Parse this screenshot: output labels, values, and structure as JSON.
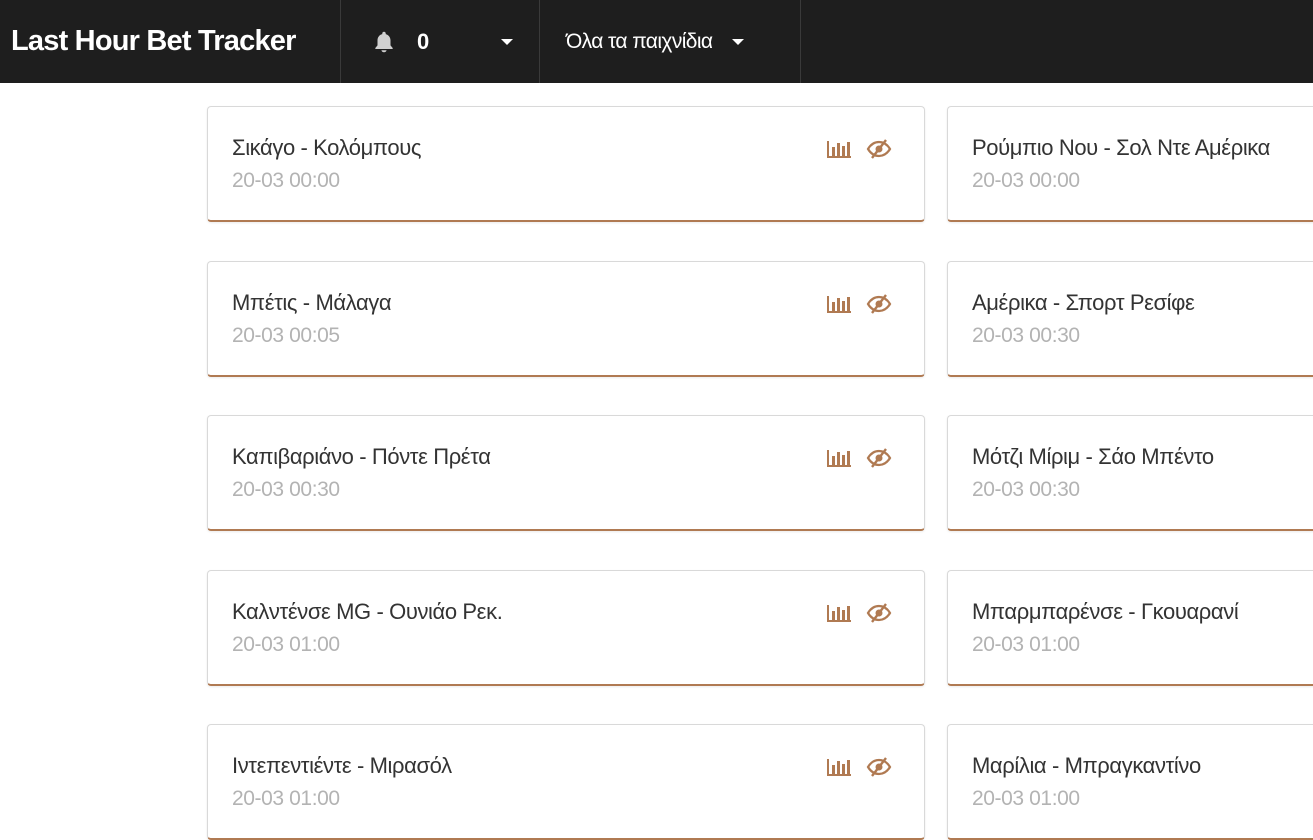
{
  "app": {
    "title": "Last Hour Bet Tracker"
  },
  "header": {
    "notification_count": "0",
    "games_filter": "Όλα τα παιχνίδια"
  },
  "colors": {
    "navbar_bg": "#1e1e1e",
    "accent": "#b07a52",
    "title_text": "#333333",
    "time_text": "#b3b3b3"
  },
  "icons": {
    "notifications": "bell-icon",
    "stats": "bar-chart-icon",
    "hide": "eye-slash-icon"
  },
  "matches_left": [
    {
      "title": "Σικάγο - Κολόμπους",
      "time": "20-03 00:00"
    },
    {
      "title": "Μπέτις - Μάλαγα",
      "time": "20-03 00:05"
    },
    {
      "title": "Καπιβαριάνο - Πόντε Πρέτα",
      "time": "20-03 00:30"
    },
    {
      "title": "Καλντένσε MG - Ουνιάο Ρεκ.",
      "time": "20-03 01:00"
    },
    {
      "title": "Ιντεπεντιέντε - Μιρασόλ",
      "time": "20-03 01:00"
    }
  ],
  "matches_right": [
    {
      "title": "Ρούμπιο Νου - Σολ Ντε Αμέρικα",
      "time": "20-03 00:00"
    },
    {
      "title": "Αμέρικα - Σπορτ Ρεσίφε",
      "time": "20-03 00:30"
    },
    {
      "title": "Μότζι Μίριμ - Σάο Μπέντο",
      "time": "20-03 00:30"
    },
    {
      "title": "Μπαρμπαρένσε - Γκουαρανί",
      "time": "20-03 01:00"
    },
    {
      "title": "Μαρίλια - Μπραγκαντίνο",
      "time": "20-03 01:00"
    }
  ]
}
